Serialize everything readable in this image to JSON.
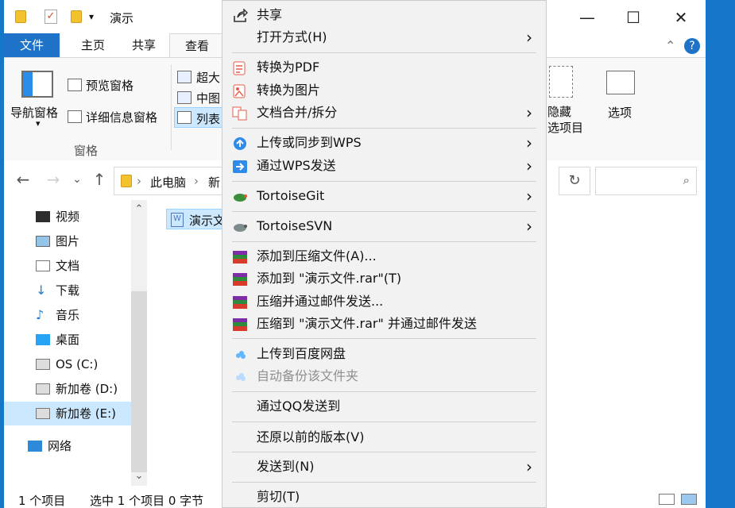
{
  "window": {
    "title": "演示",
    "controls": [
      "minimize",
      "maximize",
      "close"
    ]
  },
  "ribbon": {
    "tabs": [
      "文件",
      "主页",
      "共享",
      "查看"
    ],
    "nav_pane_label": "导航窗格",
    "preview_pane": "预览窗格",
    "details_pane": "详细信息窗格",
    "pane_group": "窗格",
    "layout_items": [
      "超大",
      "中图",
      "列表"
    ],
    "hide_selected": "隐藏\n选项目",
    "options": "选项"
  },
  "address": {
    "segments": [
      "此电脑",
      "新"
    ],
    "placeholder": ""
  },
  "sidebar": {
    "items": [
      {
        "label": "视频",
        "icon": "video-icon"
      },
      {
        "label": "图片",
        "icon": "image-icon"
      },
      {
        "label": "文档",
        "icon": "document-icon"
      },
      {
        "label": "下载",
        "icon": "download-icon"
      },
      {
        "label": "音乐",
        "icon": "music-icon"
      },
      {
        "label": "桌面",
        "icon": "desktop-icon"
      },
      {
        "label": "OS (C:)",
        "icon": "drive-icon"
      },
      {
        "label": "新加卷 (D:)",
        "icon": "drive-icon"
      },
      {
        "label": "新加卷 (E:)",
        "icon": "drive-icon"
      },
      {
        "label": "网络",
        "icon": "network-icon"
      }
    ]
  },
  "content": {
    "file_name": "演示文"
  },
  "status": {
    "items": "1 个项目",
    "selected": "选中 1 个项目  0 字节"
  },
  "context_menu": {
    "items": [
      {
        "label": "共享",
        "icon": "share-icon",
        "submenu": false,
        "disabled": false
      },
      {
        "label": "打开方式(H)",
        "icon": "",
        "submenu": true,
        "disabled": false
      },
      {
        "label": "转换为PDF",
        "icon": "pdf-convert-icon",
        "submenu": false,
        "disabled": false
      },
      {
        "label": "转换为图片",
        "icon": "image-convert-icon",
        "submenu": false,
        "disabled": false
      },
      {
        "label": "文档合并/拆分",
        "icon": "merge-split-icon",
        "submenu": true,
        "disabled": false
      },
      {
        "label": "上传或同步到WPS",
        "icon": "cloud-upload-icon",
        "submenu": true,
        "disabled": false
      },
      {
        "label": "通过WPS发送",
        "icon": "send-icon",
        "submenu": true,
        "disabled": false
      },
      {
        "label": "TortoiseGit",
        "icon": "tortoisegit-icon",
        "submenu": true,
        "disabled": false
      },
      {
        "label": "TortoiseSVN",
        "icon": "tortoisesvn-icon",
        "submenu": true,
        "disabled": false
      },
      {
        "label": "添加到压缩文件(A)...",
        "icon": "winrar-icon",
        "submenu": false,
        "disabled": false
      },
      {
        "label": "添加到 \"演示文件.rar\"(T)",
        "icon": "winrar-icon",
        "submenu": false,
        "disabled": false
      },
      {
        "label": "压缩并通过邮件发送...",
        "icon": "winrar-icon",
        "submenu": false,
        "disabled": false
      },
      {
        "label": "压缩到 \"演示文件.rar\" 并通过邮件发送",
        "icon": "winrar-icon",
        "submenu": false,
        "disabled": false
      },
      {
        "label": "上传到百度网盘",
        "icon": "baidu-cloud-icon",
        "submenu": false,
        "disabled": false
      },
      {
        "label": "自动备份该文件夹",
        "icon": "baidu-cloud-icon",
        "submenu": false,
        "disabled": true
      },
      {
        "label": "通过QQ发送到",
        "icon": "",
        "submenu": false,
        "disabled": false
      },
      {
        "label": "还原以前的版本(V)",
        "icon": "",
        "submenu": false,
        "disabled": false
      },
      {
        "label": "发送到(N)",
        "icon": "",
        "submenu": true,
        "disabled": false
      },
      {
        "label": "剪切(T)",
        "icon": "",
        "submenu": false,
        "disabled": false
      }
    ]
  }
}
